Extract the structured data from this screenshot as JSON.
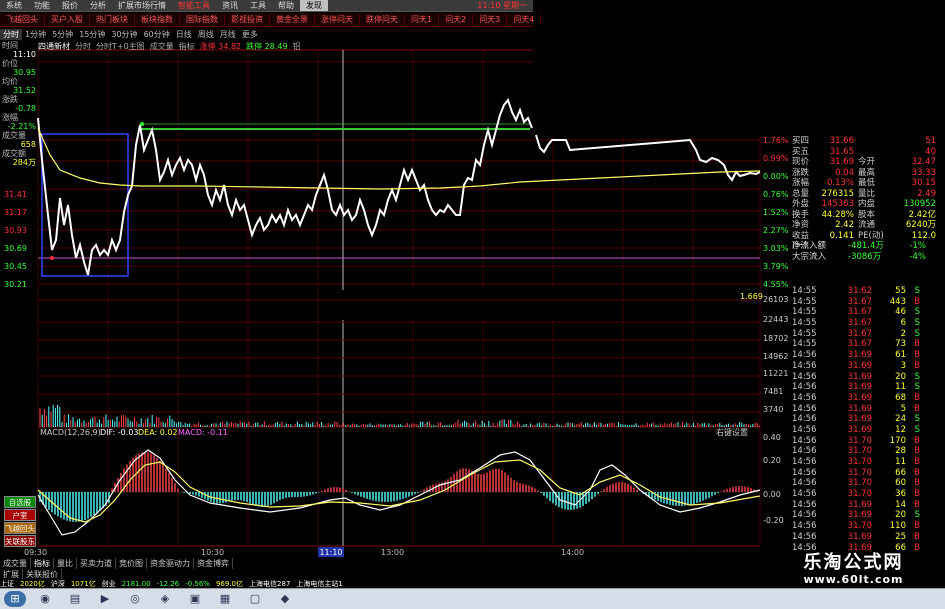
{
  "menu": {
    "items": [
      "系统",
      "功能",
      "报价",
      "分析",
      "扩展市场行情",
      "智能工具",
      "资讯",
      "工具",
      "帮助",
      "发现"
    ],
    "clock": "11:10 星期一"
  },
  "nav": {
    "items": [
      "飞越回头",
      "买户入股",
      "热门板块",
      "板块指数",
      "国际指数",
      "影视投资",
      "黄金全景",
      "涨停问天",
      "跌停问天",
      "问天1",
      "问天2",
      "问天3",
      "问天4"
    ]
  },
  "periods": {
    "items": [
      "分时",
      "1分钟",
      "5分钟",
      "15分钟",
      "30分钟",
      "60分钟",
      "日线",
      "周线",
      "月线",
      "更多"
    ]
  },
  "indicator_bar": {
    "name": "四通新材",
    "items": [
      "分时",
      "分时T+0主图",
      "成交量",
      "指标",
      "涨停 34.82",
      "跌停 28.49",
      "铝"
    ]
  },
  "left_panel": {
    "time_label": "时间",
    "time_value": "11:10",
    "price_label": "价位",
    "price_value": "30.95",
    "avg_label": "均价",
    "avg_value": "31.52",
    "change_label": "涨跌",
    "change_value": "-0.78",
    "pct_label": "涨幅",
    "pct_value": "-2.21%",
    "vol_label": "成交量",
    "vol_value": "658",
    "amt_label": "成交额",
    "amt_value": "284万"
  },
  "y_axis_left": [
    "31.41",
    "31.17",
    "30.93",
    "30.69",
    "30.45",
    "30.21"
  ],
  "y_axis_right": [
    "1.76%",
    "0.99%",
    "0.00%",
    "0.76%",
    "1.52%",
    "2.27%",
    "3.03%",
    "3.79%",
    "4.55%"
  ],
  "vol_axis": [
    "1.669",
    "26103",
    "22443",
    "18702",
    "14962",
    "11221",
    "7481",
    "3740"
  ],
  "macd": {
    "label": "MACD(12,26,9)",
    "dif": "DIF: -0.03",
    "dea": "DEA: 0.02",
    "macd": "MACD: -0.11",
    "right_label": "右键设置",
    "axis": [
      "0.40",
      "0.20",
      "0.00",
      "-0.20"
    ]
  },
  "time_axis": [
    "09:30",
    "10:30",
    "11:10",
    "13:00",
    "14:00"
  ],
  "quote": {
    "rows": [
      [
        "买四",
        "31.66",
        "",
        "51"
      ],
      [
        "买五",
        "31.65",
        "",
        "40"
      ],
      [
        "现价",
        "31.69",
        "今开",
        "32.47"
      ],
      [
        "涨跌",
        "0.04",
        "最高",
        "33.33"
      ],
      [
        "涨幅",
        "0.13%",
        "最低",
        "30.15"
      ],
      [
        "总量",
        "276315",
        "量比",
        "2.49"
      ],
      [
        "外盘",
        "145363",
        "内盘",
        "130952"
      ],
      [
        "换手",
        "44.28%",
        "股本",
        "2.42亿"
      ],
      [
        "净资",
        "2.42",
        "流通",
        "6240万"
      ],
      [
        "收益(一)",
        "0.141",
        "PE(动)",
        "112.0"
      ],
      [
        "净流入额",
        "",
        "-481.4万",
        "-1%"
      ],
      [
        "大宗流入",
        "",
        "-3086万",
        "-4%"
      ]
    ]
  },
  "ticks": [
    [
      "14:55",
      "31.62",
      "55",
      "S"
    ],
    [
      "14:55",
      "31.67",
      "443",
      "B"
    ],
    [
      "14:55",
      "31.67",
      "46",
      "S"
    ],
    [
      "14:55",
      "31.67",
      "6",
      "S"
    ],
    [
      "14:55",
      "31.67",
      "2",
      "S"
    ],
    [
      "14:55",
      "31.67",
      "73",
      "B"
    ],
    [
      "14:56",
      "31.69",
      "61",
      "B"
    ],
    [
      "14:56",
      "31.69",
      "3",
      "B"
    ],
    [
      "14:56",
      "31.69",
      "20",
      "S"
    ],
    [
      "14:56",
      "31.69",
      "11",
      "S"
    ],
    [
      "14:56",
      "31.69",
      "68",
      "B"
    ],
    [
      "14:56",
      "31.69",
      "5",
      "B"
    ],
    [
      "14:56",
      "31.69",
      "24",
      "S"
    ],
    [
      "14:56",
      "31.69",
      "12",
      "S"
    ],
    [
      "14:56",
      "31.70",
      "170",
      "B"
    ],
    [
      "14:56",
      "31.70",
      "28",
      "B"
    ],
    [
      "14:56",
      "31.70",
      "11",
      "B"
    ],
    [
      "14:56",
      "31.70",
      "66",
      "B"
    ],
    [
      "14:56",
      "31.70",
      "60",
      "B"
    ],
    [
      "14:56",
      "31.70",
      "36",
      "B"
    ],
    [
      "14:56",
      "31.69",
      "14",
      "B"
    ],
    [
      "14:56",
      "31.69",
      "20",
      "S"
    ],
    [
      "14:56",
      "31.70",
      "110",
      "B"
    ],
    [
      "14:56",
      "31.69",
      "25",
      "B"
    ],
    [
      "14:56",
      "31.69",
      "66",
      "B"
    ]
  ],
  "side_buttons": [
    "自选股",
    "户室",
    "飞越回头",
    "关联股东"
  ],
  "bottom_tabs": [
    "成交量",
    "指标",
    "量比",
    "买卖力道",
    "竞价图",
    "资金驱动力",
    "资金博弈"
  ],
  "bottom_tabs2": [
    "扩展",
    "关联报价"
  ],
  "status": [
    "上证",
    "2020亿",
    "沪深",
    "1071亿",
    "创业",
    "2181.00",
    "-12.26",
    "-0.56%",
    "969.0亿",
    "上海电信287",
    "上海电信主站1"
  ],
  "watermark": {
    "line1": "乐淘公式网",
    "line2": "www.60lt.com"
  },
  "colors": {
    "up": "#ff3333",
    "down": "#33ff33",
    "price_line": "#ffffff",
    "avg_line": "#ffff66",
    "grid": "#660000"
  }
}
